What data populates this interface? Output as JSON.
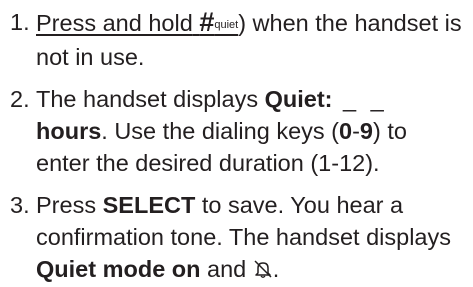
{
  "steps": [
    {
      "number": "1.",
      "press_hold": "Press and hold",
      "hash_key": "#",
      "hash_label": "quiet",
      "close_paren": ")",
      "rest": " when the handset is not in use."
    },
    {
      "number": "2.",
      "t1": "The handset displays ",
      "b1": "Quiet:",
      "blanks": " _ _",
      "b2": "hours",
      "t2": ". Use the dialing keys (",
      "k1": "0",
      "dash": "-",
      "k2": "9",
      "t3": ") to enter the desired duration (1-12)."
    },
    {
      "number": "3.",
      "t1": "Press ",
      "b1": "SELECT",
      "t2": " to save. You hear a confirmation tone. The handset displays ",
      "b2": "Quiet mode on",
      "t3": " and ",
      "icon": "bell-off-icon",
      "t4": "."
    }
  ]
}
